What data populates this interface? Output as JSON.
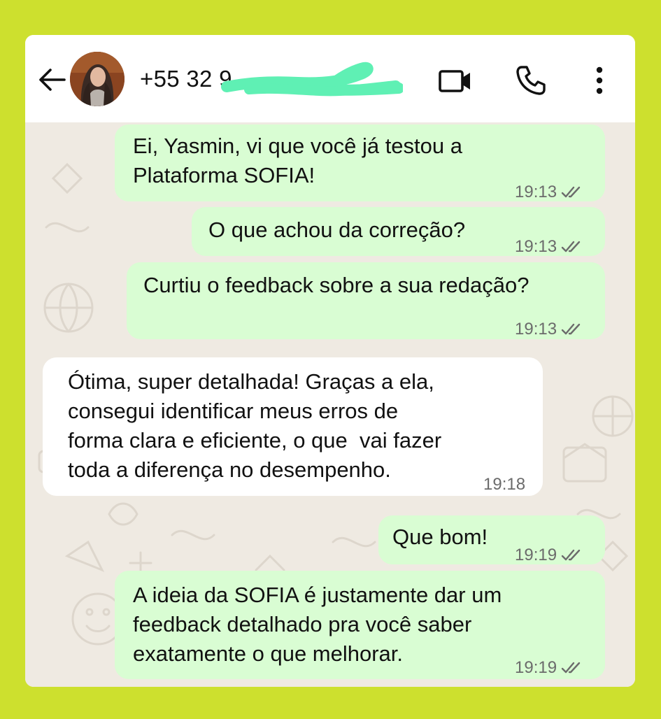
{
  "theme": {
    "frame_bg": "#cde02e",
    "outgoing_bubble": "#d9fdd3",
    "incoming_bubble": "#ffffff",
    "chat_bg": "#efeae2"
  },
  "header": {
    "back_icon": "arrow-left-icon",
    "contact": "+55 32 9",
    "contact_redacted": true,
    "icons": [
      "video-call-icon",
      "phone-icon",
      "more-vert-icon"
    ]
  },
  "messages": [
    {
      "direction": "out",
      "text": "Ei, Yasmin, vi que você já testou a\nPlataforma SOFIA!",
      "time": "19:13",
      "status": "read"
    },
    {
      "direction": "out",
      "text": "O que achou da correção?",
      "time": "19:13",
      "status": "read"
    },
    {
      "direction": "out",
      "text": "Curtiu o feedback sobre a sua redação?",
      "time": "19:13",
      "status": "read"
    },
    {
      "direction": "in",
      "text": "Ótima, super detalhada! Graças a ela,\nconsegui identificar meus erros de\nforma clara e eficiente, o que  vai fazer\ntoda a diferença no desempenho.",
      "time": "19:18"
    },
    {
      "direction": "out",
      "text": "Que bom!",
      "time": "19:19",
      "status": "read"
    },
    {
      "direction": "out",
      "text": "A ideia da SOFIA é justamente dar um\nfeedback detalhado pra você saber\nexatamente o que melhorar.",
      "time": "19:19",
      "status": "read"
    }
  ]
}
